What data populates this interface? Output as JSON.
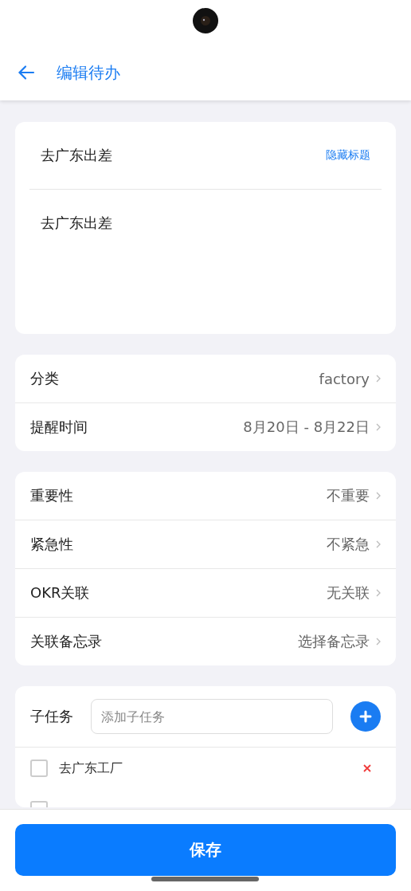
{
  "header": {
    "title": "编辑待办"
  },
  "note": {
    "title": "去广东出差",
    "hide_title_link": "隐藏标题",
    "body": "去广东出差"
  },
  "settings_groups": [
    {
      "rows": [
        {
          "label": "分类",
          "value": "factory"
        },
        {
          "label": "提醒时间",
          "value": "8月20日 - 8月22日"
        }
      ]
    },
    {
      "rows": [
        {
          "label": "重要性",
          "value": "不重要"
        },
        {
          "label": "紧急性",
          "value": "不紧急"
        },
        {
          "label": "OKR关联",
          "value": "无关联"
        },
        {
          "label": "关联备忘录",
          "value": "选择备忘录"
        }
      ]
    }
  ],
  "subtasks": {
    "label": "子任务",
    "placeholder": "添加子任务",
    "items": [
      {
        "kind": "full",
        "text": "去广东工厂",
        "checked": false
      },
      {
        "kind": "covered",
        "checked": false
      }
    ]
  },
  "save_button": "保存"
}
